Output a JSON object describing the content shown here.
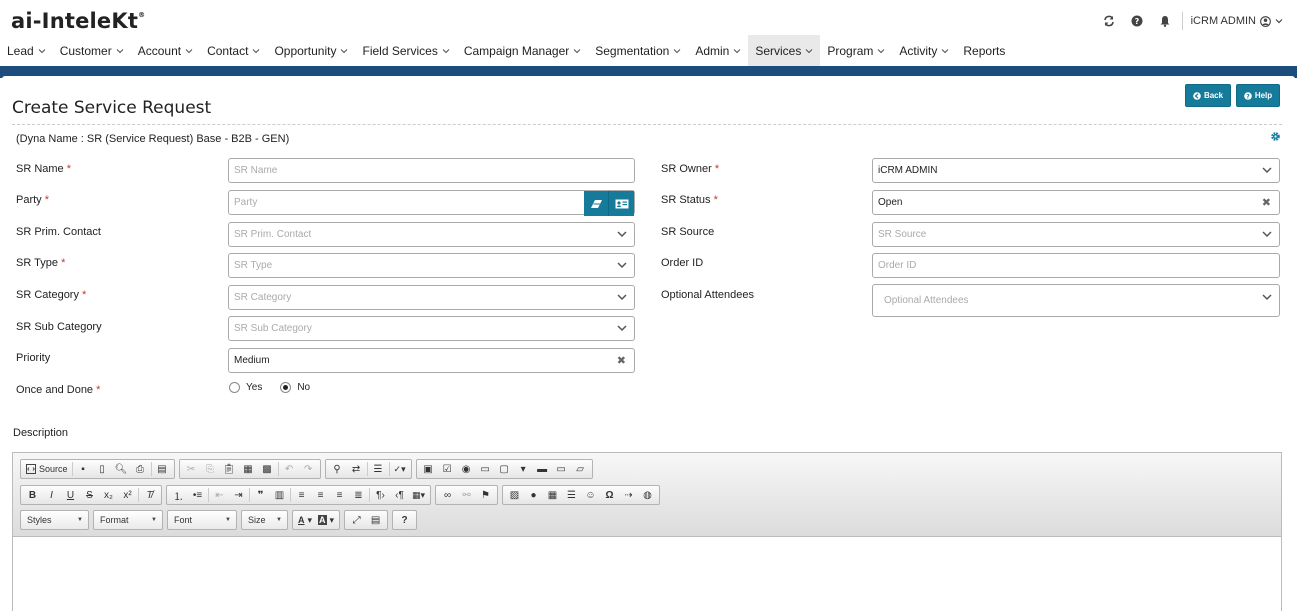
{
  "app": {
    "logo_text": "ai-InteleKt",
    "logo_mark": "®",
    "user_name": "iCRM ADMIN"
  },
  "nav": [
    {
      "label": "Lead",
      "has_menu": true,
      "active": false
    },
    {
      "label": "Customer",
      "has_menu": true,
      "active": false
    },
    {
      "label": "Account",
      "has_menu": true,
      "active": false
    },
    {
      "label": "Contact",
      "has_menu": true,
      "active": false
    },
    {
      "label": "Opportunity",
      "has_menu": true,
      "active": false
    },
    {
      "label": "Field Services",
      "has_menu": true,
      "active": false
    },
    {
      "label": "Campaign Manager",
      "has_menu": true,
      "active": false
    },
    {
      "label": "Segmentation",
      "has_menu": true,
      "active": false
    },
    {
      "label": "Admin",
      "has_menu": true,
      "active": false
    },
    {
      "label": "Services",
      "has_menu": true,
      "active": true
    },
    {
      "label": "Program",
      "has_menu": true,
      "active": false
    },
    {
      "label": "Activity",
      "has_menu": true,
      "active": false
    },
    {
      "label": "Reports",
      "has_menu": false,
      "active": false
    }
  ],
  "page": {
    "title": "Create Service Request",
    "back_label": "Back",
    "help_label": "Help",
    "dyna_name": "(Dyna Name : SR (Service Request) Base - B2B - GEN)"
  },
  "form": {
    "sr_name": {
      "label": "SR Name",
      "required": "*",
      "placeholder": "SR Name"
    },
    "party": {
      "label": "Party",
      "required": "*",
      "placeholder": "Party"
    },
    "sr_prim_contact": {
      "label": "SR Prim. Contact",
      "placeholder": "SR Prim. Contact"
    },
    "sr_type": {
      "label": "SR Type",
      "required": "*",
      "placeholder": "SR Type"
    },
    "sr_category": {
      "label": "SR Category",
      "required": "*",
      "placeholder": "SR Category"
    },
    "sr_sub_category": {
      "label": "SR Sub Category",
      "placeholder": "SR Sub Category"
    },
    "priority": {
      "label": "Priority",
      "value": "Medium"
    },
    "once_and_done": {
      "label": "Once and Done",
      "required": "*",
      "option_yes": "Yes",
      "option_no": "No",
      "selected": "No"
    },
    "sr_owner": {
      "label": "SR Owner",
      "required": "*",
      "value": "iCRM ADMIN"
    },
    "sr_status": {
      "label": "SR Status",
      "required": "*",
      "value": "Open"
    },
    "sr_source": {
      "label": "SR Source",
      "placeholder": "SR Source"
    },
    "order_id": {
      "label": "Order ID",
      "placeholder": "Order ID"
    },
    "optional_attendees": {
      "label": "Optional Attendees",
      "placeholder": "Optional Attendees"
    },
    "description_label": "Description"
  },
  "editor": {
    "source_label": "Source",
    "combos": [
      "Styles",
      "Format",
      "Font",
      "Size"
    ]
  },
  "colors": {
    "accent": "#167b9a",
    "band": "#1c4d7c",
    "required": "#c0392b"
  }
}
